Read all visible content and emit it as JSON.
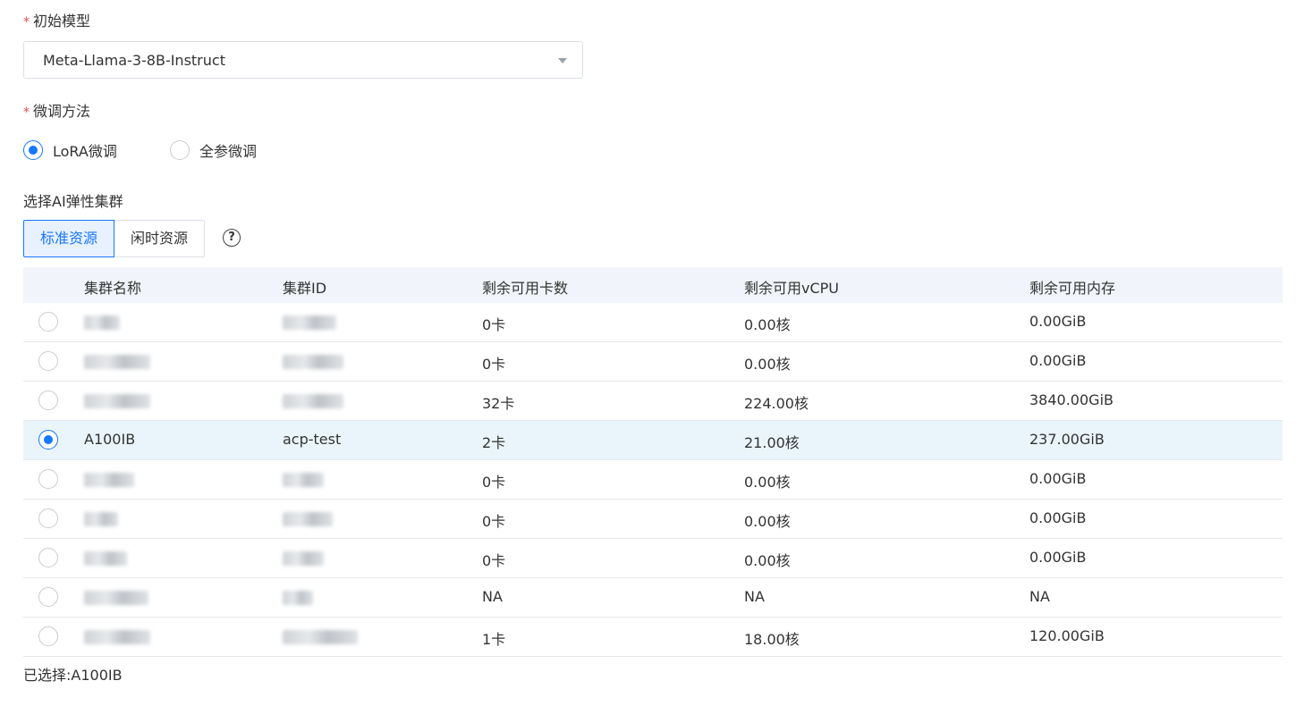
{
  "model_field": {
    "required_mark": "*",
    "label": "初始模型",
    "selected_value": "Meta-Llama-3-8B-Instruct"
  },
  "method_field": {
    "required_mark": "*",
    "label": "微调方法",
    "options": [
      {
        "label": "LoRA微调",
        "checked": true
      },
      {
        "label": "全参微调",
        "checked": false
      }
    ]
  },
  "cluster_field": {
    "label": "选择AI弹性集群",
    "tabs": [
      {
        "label": "标准资源",
        "active": true
      },
      {
        "label": "闲时资源",
        "active": false
      }
    ],
    "help_glyph": "?"
  },
  "table": {
    "headers": [
      "集群名称",
      "集群ID",
      "剩余可用卡数",
      "剩余可用vCPU",
      "剩余可用内存"
    ],
    "rows": [
      {
        "name": "",
        "id": "",
        "cards": "0卡",
        "vcpu": "0.00核",
        "memory": "0.00GiB",
        "selected": false
      },
      {
        "name": "",
        "id": "",
        "cards": "0卡",
        "vcpu": "0.00核",
        "memory": "0.00GiB",
        "selected": false
      },
      {
        "name": "",
        "id": "",
        "cards": "32卡",
        "vcpu": "224.00核",
        "memory": "3840.00GiB",
        "selected": false
      },
      {
        "name": "A100IB",
        "id": "acp-test",
        "cards": "2卡",
        "vcpu": "21.00核",
        "memory": "237.00GiB",
        "selected": true
      },
      {
        "name": "",
        "id": "",
        "cards": "0卡",
        "vcpu": "0.00核",
        "memory": "0.00GiB",
        "selected": false
      },
      {
        "name": "",
        "id": "",
        "cards": "0卡",
        "vcpu": "0.00核",
        "memory": "0.00GiB",
        "selected": false
      },
      {
        "name": "",
        "id": "",
        "cards": "0卡",
        "vcpu": "0.00核",
        "memory": "0.00GiB",
        "selected": false
      },
      {
        "name": "",
        "id": "",
        "cards": "NA",
        "vcpu": "NA",
        "memory": "NA",
        "selected": false
      },
      {
        "name": "",
        "id": "",
        "cards": "1卡",
        "vcpu": "18.00核",
        "memory": "120.00GiB",
        "selected": false
      }
    ]
  },
  "summary": "已选择:A100IB",
  "colors": {
    "accent": "#1677ff",
    "required": "#e34d59",
    "header_bg": "#f1f4fa",
    "selected_row_bg": "#eaf5fb"
  }
}
